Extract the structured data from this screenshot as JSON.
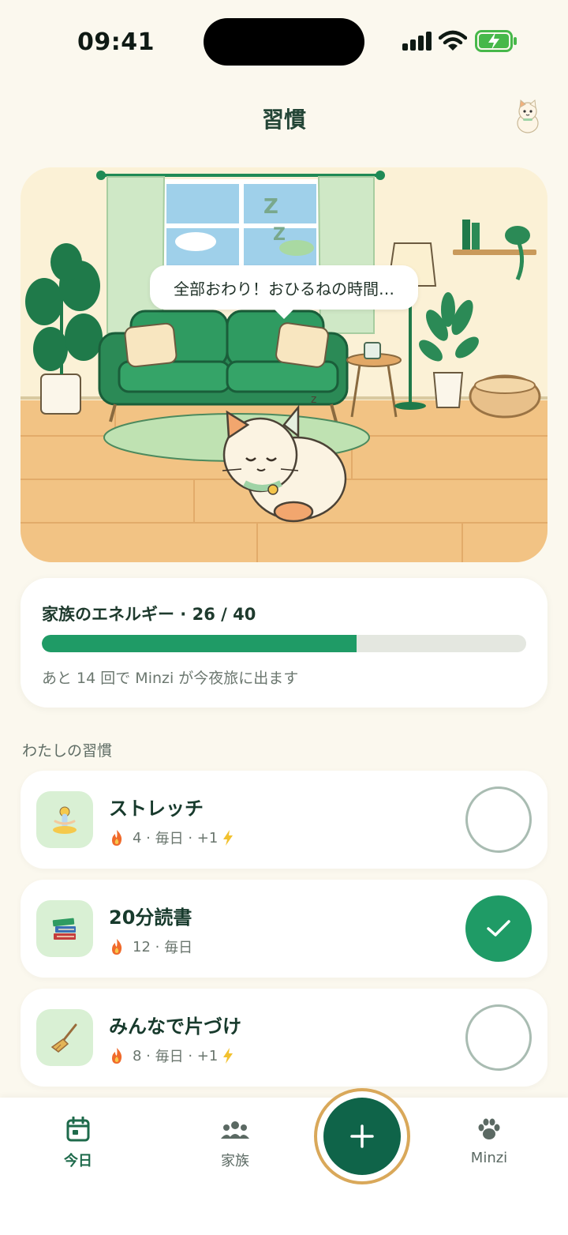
{
  "status": {
    "time": "09:41"
  },
  "header": {
    "title": "習慣"
  },
  "scene": {
    "bubble": "全部おわり！おひるねの時間…"
  },
  "energy": {
    "title": "家族のエネルギー · 26 / 40",
    "current": 26,
    "max": 40,
    "subtitle": "あと 14 回で Minzi が今夜旅に出ます"
  },
  "section": {
    "label": "わたしの習慣"
  },
  "habits": [
    {
      "name": "ストレッチ",
      "streak": "4",
      "frequency": "毎日",
      "bonus": "+1",
      "icon": "yoga-icon",
      "done": false
    },
    {
      "name": "20分読書",
      "streak": "12",
      "frequency": "毎日",
      "bonus": "",
      "icon": "books-icon",
      "done": true
    },
    {
      "name": "みんなで片づけ",
      "streak": "8",
      "frequency": "毎日",
      "bonus": "+1",
      "icon": "broom-icon",
      "done": false
    }
  ],
  "tabs": {
    "today": "今日",
    "family": "家族",
    "minzi": "Minzi"
  },
  "colors": {
    "accent": "#1f9b66",
    "fab": "#0f6449",
    "fab_ring": "#d9a85a",
    "background": "#fbf8ee"
  }
}
